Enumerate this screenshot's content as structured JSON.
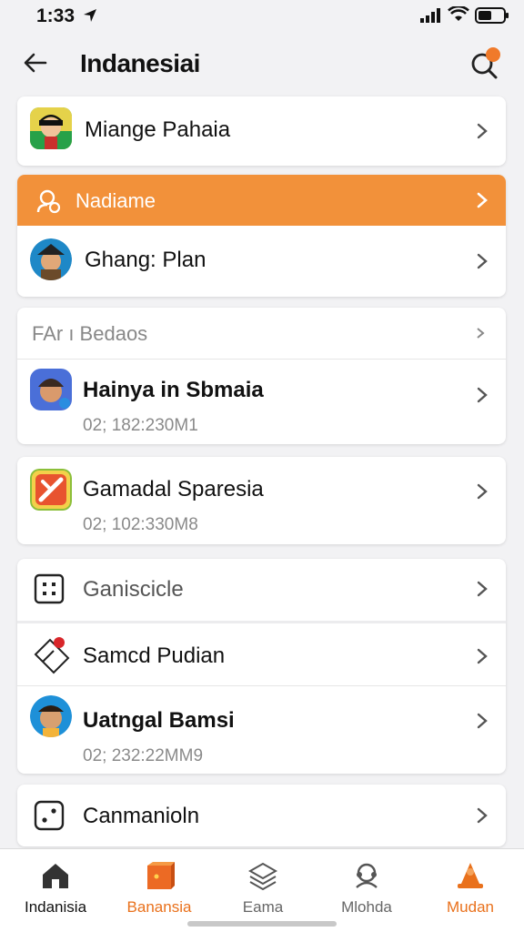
{
  "status_bar": {
    "time": "1:33"
  },
  "header": {
    "title": "Indanesiai"
  },
  "items": {
    "item1": {
      "label": "Miange Pahaia"
    },
    "banner": {
      "label": "Nadiame"
    },
    "item2": {
      "label": "Ghang: Plan"
    },
    "section_title": "FAr ı Bedaos",
    "item3": {
      "label": "Hainya in Sbmaia",
      "sub": "02; 182:230M1"
    },
    "item4": {
      "label": "Gamadal Sparesia",
      "sub": "02; 102:330M8"
    },
    "item5": {
      "label": "Ganiscicle"
    },
    "item6": {
      "label": "Samcd Pudian"
    },
    "item7": {
      "label": "Uatngal Bamsi",
      "sub": "02; 232:22MM9"
    },
    "item8": {
      "label": "Canmaniоln"
    }
  },
  "bottom_nav": [
    {
      "label": "Indanisia",
      "icon": "home-icon"
    },
    {
      "label": "Banansia",
      "icon": "orange-box-icon"
    },
    {
      "label": "Eama",
      "icon": "layers-icon"
    },
    {
      "label": "Mlohda",
      "icon": "headset-icon"
    },
    {
      "label": "Mudan",
      "icon": "cone-icon"
    }
  ],
  "colors": {
    "accent": "#f2913a",
    "active_nav": "#e9711c",
    "text": "#111111",
    "muted": "#8a8a8a"
  }
}
